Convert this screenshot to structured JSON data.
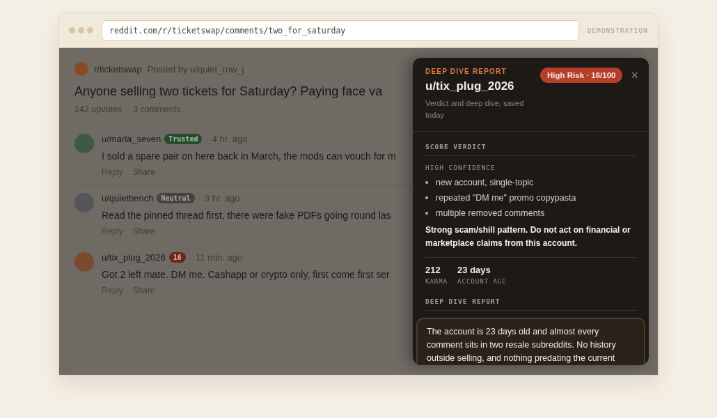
{
  "browser": {
    "url": "reddit.com/r/ticketswap/comments/two_for_saturday",
    "label": "DEMONSTRATION"
  },
  "post": {
    "subreddit": "r/ticketswap",
    "posted_by": "Posted by u/quiet_row_j",
    "title": "Anyone selling two tickets for Saturday? Paying face va",
    "upvotes": "142 upvotes",
    "separator": "·",
    "comments_count": "3 comments"
  },
  "comments": [
    {
      "author": "u/marla_seven",
      "color": "#3f5a44",
      "badge": {
        "text": "Trusted",
        "kind": "trusted"
      },
      "separator": "·",
      "time": "4 hr. ago",
      "text": "I sold a spare pair on here back in March, the mods can vouch for m",
      "actions": [
        "Reply",
        "Share"
      ]
    },
    {
      "author": "u/quietbench",
      "color": "#54565a",
      "badge": {
        "text": "Neutral",
        "kind": "neutral"
      },
      "separator": "·",
      "time": "3 hr. ago",
      "text": "Read the pinned thread first, there were fake PDFs going round las",
      "actions": [
        "Reply",
        "Share"
      ]
    },
    {
      "author": "u/tix_plug_2026",
      "color": "#7a4a2e",
      "badge": {
        "text": "16",
        "kind": "risk"
      },
      "separator": "·",
      "time": "11 min. ago",
      "text": "Got 2 left mate. DM me. Cashapp or crypto only, first come first ser",
      "actions": [
        "Reply",
        "Share"
      ]
    }
  ],
  "panel": {
    "eyebrow": "DEEP DIVE REPORT",
    "username": "u/tix_plug_2026",
    "subtitle": "Verdict and deep dive, saved today",
    "risk_badge": "High Risk · 16/100",
    "close": "×",
    "verdict": {
      "heading": "SCORE VERDICT",
      "confidence": "HIGH CONFIDENCE",
      "points": [
        "new account, single-topic",
        "repeated \"DM me\" promo copypasta",
        "multiple removed comments"
      ],
      "summary": "Strong scam/shill pattern. Do not act on financial or marketplace claims from this account."
    },
    "stats": [
      {
        "value": "212",
        "label": "KARMA"
      },
      {
        "value": "23 days",
        "label": "ACCOUNT AGE"
      }
    ],
    "report": {
      "heading": "DEEP DIVE REPORT",
      "text": "The account is 23 days old and almost every comment sits in two resale subreddits. No history outside selling, and nothing predating the current"
    }
  }
}
